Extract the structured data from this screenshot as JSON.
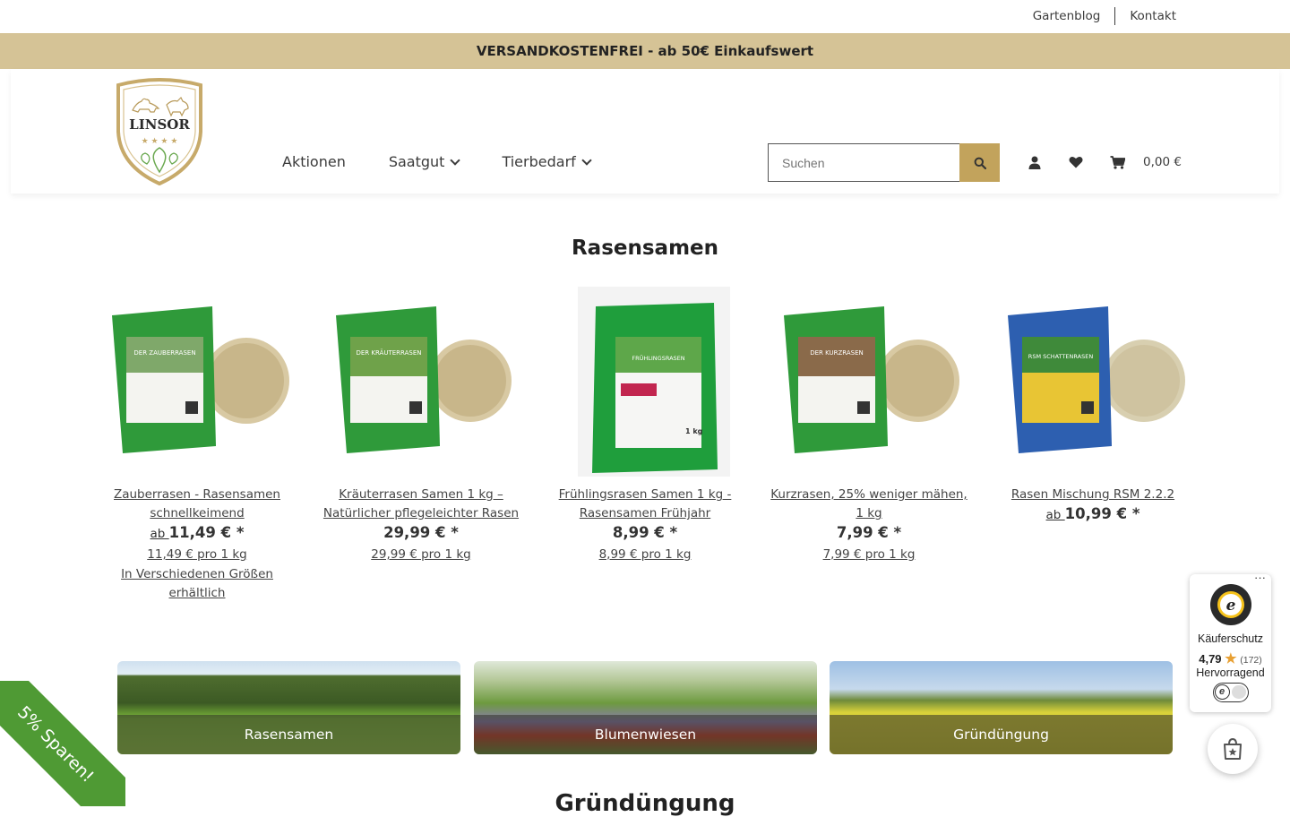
{
  "topbar": {
    "links": [
      "Gartenblog",
      "Kontakt"
    ]
  },
  "banner": {
    "text": "VERSANDKOSTENFREI - ab 50€ Einkaufswert"
  },
  "header": {
    "logo_text": "LINSOR",
    "nav": [
      {
        "label": "Aktionen",
        "dropdown": false
      },
      {
        "label": "Saatgut",
        "dropdown": true
      },
      {
        "label": "Tierbedarf",
        "dropdown": true
      }
    ],
    "search_placeholder": "Suchen",
    "cart_total": "0,00 €"
  },
  "section_title": "Rasensamen",
  "products": [
    {
      "name": "Zauberrasen - Rasensamen schnellkeimend",
      "price_prefix": "ab ",
      "price": "11,49 € *",
      "base_price": "11,49 € pro 1 kg",
      "note": "In Verschiedenen Größen erhältlich",
      "bag_color": "#2f9a3a",
      "bag_label": "DER ZAUBERRASEN"
    },
    {
      "name": "Kräuterrasen Samen 1 kg – Natürlicher pflegeleichter Rasen",
      "price_prefix": "",
      "price": "29,99 € *",
      "base_price": "29,99 € pro 1 kg",
      "note": "",
      "bag_color": "#2f9a3a",
      "bag_label": "DER KRÄUTERRASEN"
    },
    {
      "name": "Frühlingsrasen Samen 1 kg - Rasensamen Frühjahr",
      "price_prefix": "",
      "price": "8,99 € *",
      "base_price": "8,99 € pro 1 kg",
      "note": "",
      "bag_color": "#1f9e3c",
      "bag_label": "FRÜHLINGSRASEN"
    },
    {
      "name": "Kurzrasen, 25% weniger mähen, 1 kg",
      "price_prefix": "",
      "price": "7,99 € *",
      "base_price": "7,99 € pro 1 kg",
      "note": "",
      "bag_color": "#2f9a3a",
      "bag_label": "DER KURZRASEN"
    },
    {
      "name": "Rasen Mischung RSM 2.2.2",
      "price_prefix": "ab ",
      "price": "10,99 € *",
      "base_price": "",
      "note": "",
      "bag_color": "#2d5fb0",
      "bag_label": "RSM SCHATTENRASEN"
    }
  ],
  "categories": [
    {
      "label": "Rasensamen"
    },
    {
      "label": "Blumenwiesen"
    },
    {
      "label": "Gründüngung"
    }
  ],
  "bottom_title": "Gründüngung",
  "ribbon": "5% Sparen!",
  "trusted_shops": {
    "protection": "Käuferschutz",
    "score": "4,79",
    "count": "(172)",
    "label": "Hervorragend"
  },
  "colors": {
    "banner": "#d5c396",
    "search_button": "#c2a35c",
    "ribbon": "#4f9a34"
  }
}
